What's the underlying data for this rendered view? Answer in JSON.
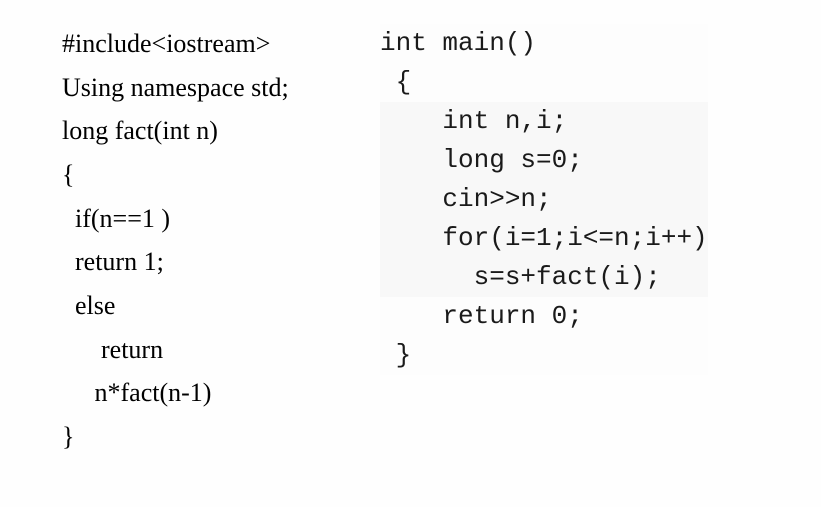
{
  "left": {
    "l1": "#include<iostream>",
    "l2": "Using namespace std;",
    "l3": "long fact(int n)",
    "l4": "{",
    "l5": "  if(n==1 )",
    "l6": "  return 1;",
    "l7": "  else",
    "l8": "      return",
    "l9": "     n*fact(n-1)",
    "l10": "}"
  },
  "right": {
    "r1": "int main()",
    "r2": " {",
    "r3": "    int n,i;",
    "r4": "    long s=0;",
    "r5": "    cin>>n;",
    "r6": "    for(i=1;i<=n;i++)",
    "r7": "      s=s+fact(i);",
    "r8": "    return 0;",
    "r9": " }"
  }
}
